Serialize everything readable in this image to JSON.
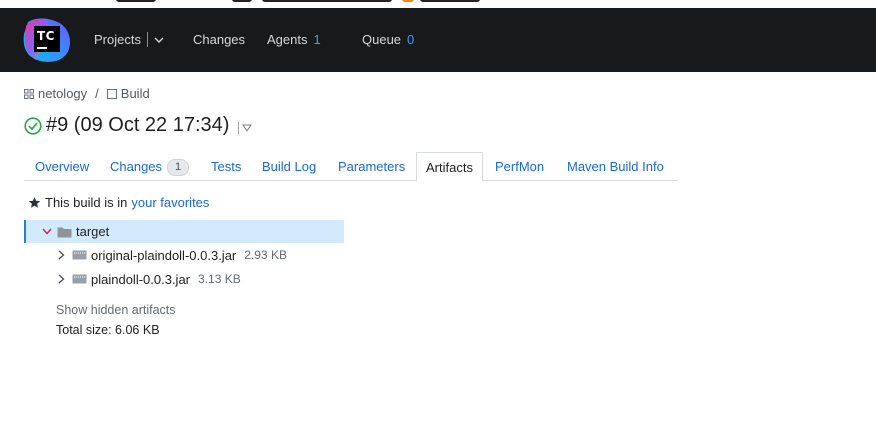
{
  "header": {
    "logo_text": "TC",
    "nav": {
      "projects": "Projects",
      "changes": "Changes",
      "agents": "Agents",
      "agents_count": "1",
      "queue": "Queue",
      "queue_count": "0"
    }
  },
  "breadcrumb": {
    "project": "netology",
    "separator": "/",
    "build_config": "Build"
  },
  "build": {
    "title": "#9 (09 Oct 22 17:34)",
    "status": "success"
  },
  "tabs": [
    {
      "label": "Overview"
    },
    {
      "label": "Changes",
      "count": "1"
    },
    {
      "label": "Tests"
    },
    {
      "label": "Build Log"
    },
    {
      "label": "Parameters"
    },
    {
      "label": "Artifacts",
      "active": true
    },
    {
      "label": "PerfMon"
    },
    {
      "label": "Maven Build Info"
    }
  ],
  "favorites": {
    "text": "This build is in",
    "link": "your favorites"
  },
  "artifacts": {
    "folder": "target",
    "files": [
      {
        "name": "original-plaindoll-0.0.3.jar",
        "size": "2.93 KB"
      },
      {
        "name": "plaindoll-0.0.3.jar",
        "size": "3.13 KB"
      }
    ],
    "show_hidden": "Show hidden artifacts",
    "total": "Total size: 6.06 KB"
  },
  "colors": {
    "header_bg": "#18191b",
    "link": "#1b6ac9",
    "count": "#3d9eff",
    "selection": "#d3e9fc",
    "success": "#28a745",
    "accent": "#e02060"
  }
}
